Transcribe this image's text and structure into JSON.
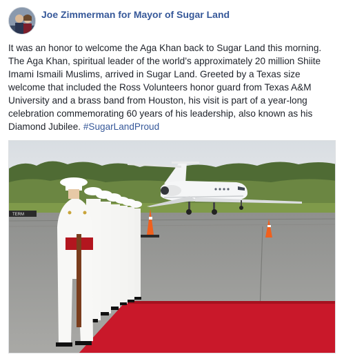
{
  "post": {
    "author": "Joe Zimmerman for Mayor of Sugar Land",
    "body": "It was an honor to welcome the Aga Khan back to Sugar Land this morning. The Aga Khan, spiritual leader of the world’s approximately 20 million Shiite Imami Ismaili Muslims, arrived in Sugar Land. Greeted by a Texas size welcome that included the Ross Volunteers honor guard from Texas A&M University and a brass band from Houston, his visit is part of a year-long celebration commemorating 60 years of his leadership, also known as his Diamond Jubilee.",
    "hashtag": "#SugarLandProud"
  },
  "colors": {
    "link": "#365899",
    "text": "#1d2129",
    "carpet": "#c9182a",
    "tarmac": "#9a9a98",
    "grass": "#7f9a4a",
    "sky": "#dfe3e6"
  },
  "photo": {
    "sign_text": "TERM"
  }
}
